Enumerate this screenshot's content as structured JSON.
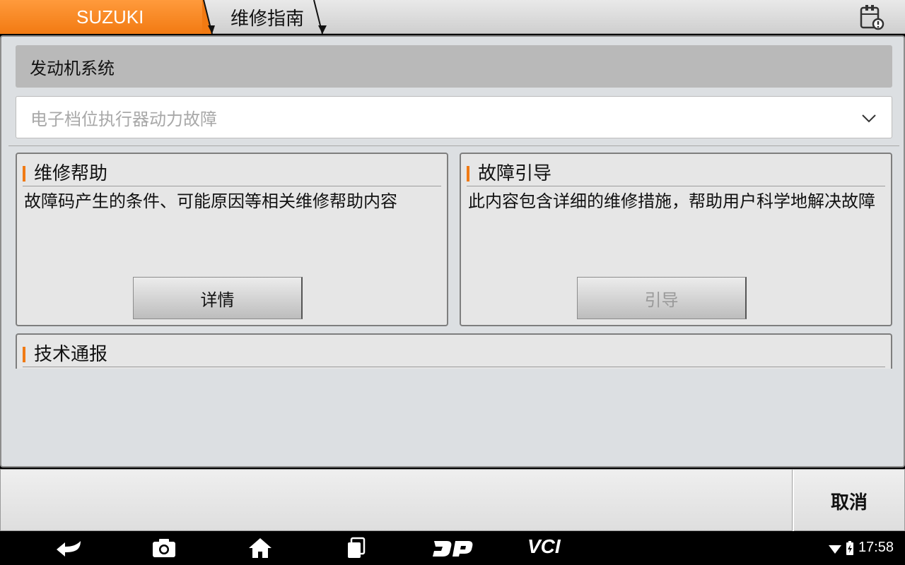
{
  "header": {
    "brand": "SUZUKI",
    "page": "维修指南",
    "report_icon": "report-clipboard-icon"
  },
  "main": {
    "system": "发动机系统",
    "fault_select": {
      "value": "电子档位执行器动力故障",
      "icon": "chevron-down-icon"
    },
    "cards": {
      "repair_help": {
        "title": "维修帮助",
        "desc": "故障码产生的条件、可能原因等相关维修帮助内容",
        "button": "详情"
      },
      "fault_guide": {
        "title": "故障引导",
        "desc": "此内容包含详细的维修措施，帮助用户科学地解决故障",
        "button": "引导"
      },
      "tech_bulletin": {
        "title": "技术通报"
      }
    }
  },
  "bottom": {
    "cancel": "取消"
  },
  "navbar": {
    "icons": [
      "back-icon",
      "camera-icon",
      "home-icon",
      "recent-apps-icon",
      "dp-icon",
      "vci-icon"
    ],
    "vci_text": "VCI",
    "time": "17:58"
  },
  "colors": {
    "accent": "#f27a12",
    "panel": "#dcdfe2",
    "card": "#e6e6e6"
  }
}
